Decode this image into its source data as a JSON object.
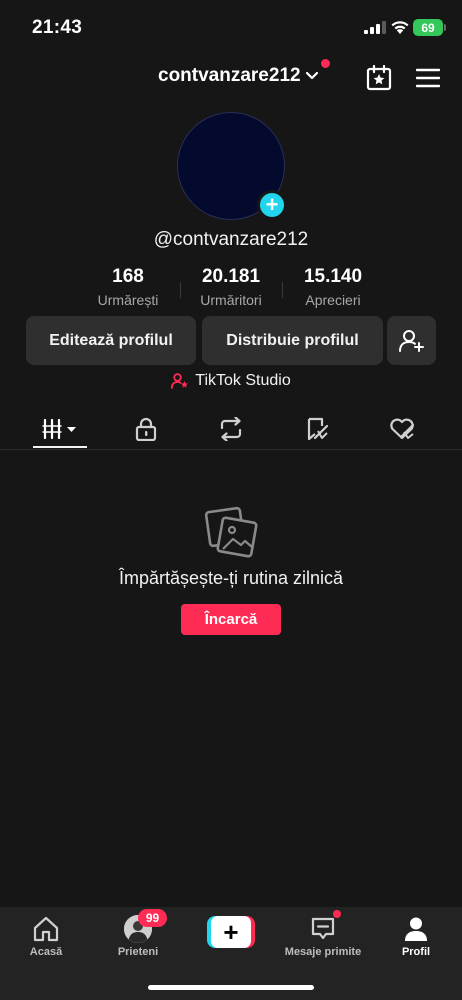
{
  "status_bar": {
    "time": "21:43",
    "battery": "69"
  },
  "header": {
    "username": "contvanzare212"
  },
  "profile": {
    "handle": "@contvanzare212",
    "avatar_add": "+"
  },
  "stats": [
    {
      "value": "168",
      "label": "Urmărești"
    },
    {
      "value": "20.181",
      "label": "Urmăritori"
    },
    {
      "value": "15.140",
      "label": "Aprecieri"
    }
  ],
  "actions": {
    "edit_profile": "Editează profilul",
    "share_profile": "Distribuie profilul"
  },
  "studio": {
    "label": "TikTok Studio"
  },
  "tabs": [
    {
      "icon": "grid-filter-icon",
      "active": true
    },
    {
      "icon": "lock-icon"
    },
    {
      "icon": "repost-icon"
    },
    {
      "icon": "favorites-icon"
    },
    {
      "icon": "liked-icon"
    }
  ],
  "empty_state": {
    "title": "Împărtășește-ți rutina zilnică",
    "button": "Încarcă"
  },
  "bottom_nav": {
    "home": "Acasă",
    "friends": "Prieteni",
    "friends_badge": "99",
    "create": "+",
    "inbox": "Mesaje primite",
    "profile": "Profil"
  },
  "colors": {
    "accent": "#fe2c55",
    "cyan": "#20d5ec",
    "background": "#161616",
    "battery": "#34c759"
  }
}
